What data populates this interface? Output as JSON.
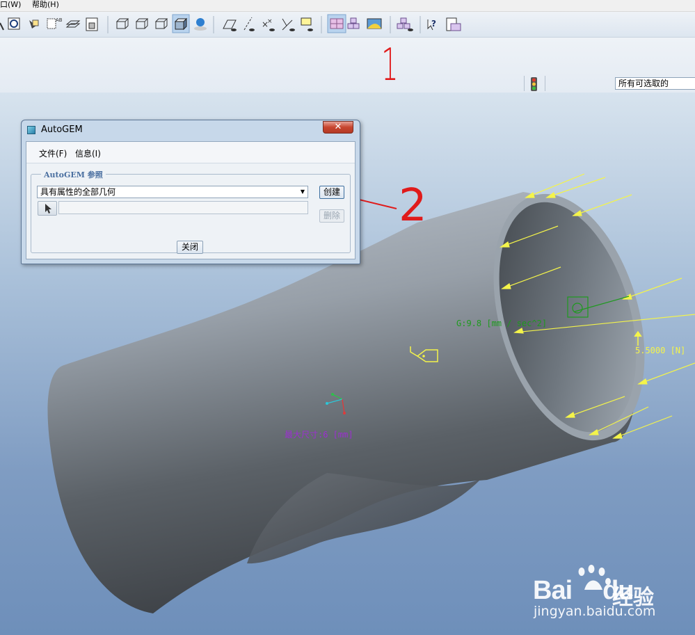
{
  "menubar": {
    "window": "口(W)",
    "help": "帮助(H)"
  },
  "toolbar": {
    "active_tool": "autogem-mesh-icon"
  },
  "filter": {
    "value": "所有可选取的"
  },
  "dialog": {
    "title": "AutoGEM",
    "close_glyph": "✕",
    "menu": {
      "file": "文件(F)",
      "info": "信息(I)"
    },
    "group_title": "AutoGEM 参照",
    "geometry_value": "具有属性的全部几何",
    "create_label": "创建",
    "delete_label": "删除",
    "close_label": "关闭"
  },
  "annotations": {
    "step1": "1",
    "step2": "2"
  },
  "model_labels": {
    "gravity": "G:9.8 [mm / sec^2]",
    "force": "5.5000 [N]",
    "mesh_size": "最大尺寸:6 [mm]"
  },
  "colors": {
    "annotation_red": "#e01b1b",
    "force_yellow": "#f4f44a",
    "gravity_green": "#1e9a1e",
    "mesh_purple": "#9c2fd0"
  },
  "watermark": {
    "brand": "Bai",
    "brand2": "du",
    "product": "经验",
    "url": "jingyan.baidu.com"
  }
}
